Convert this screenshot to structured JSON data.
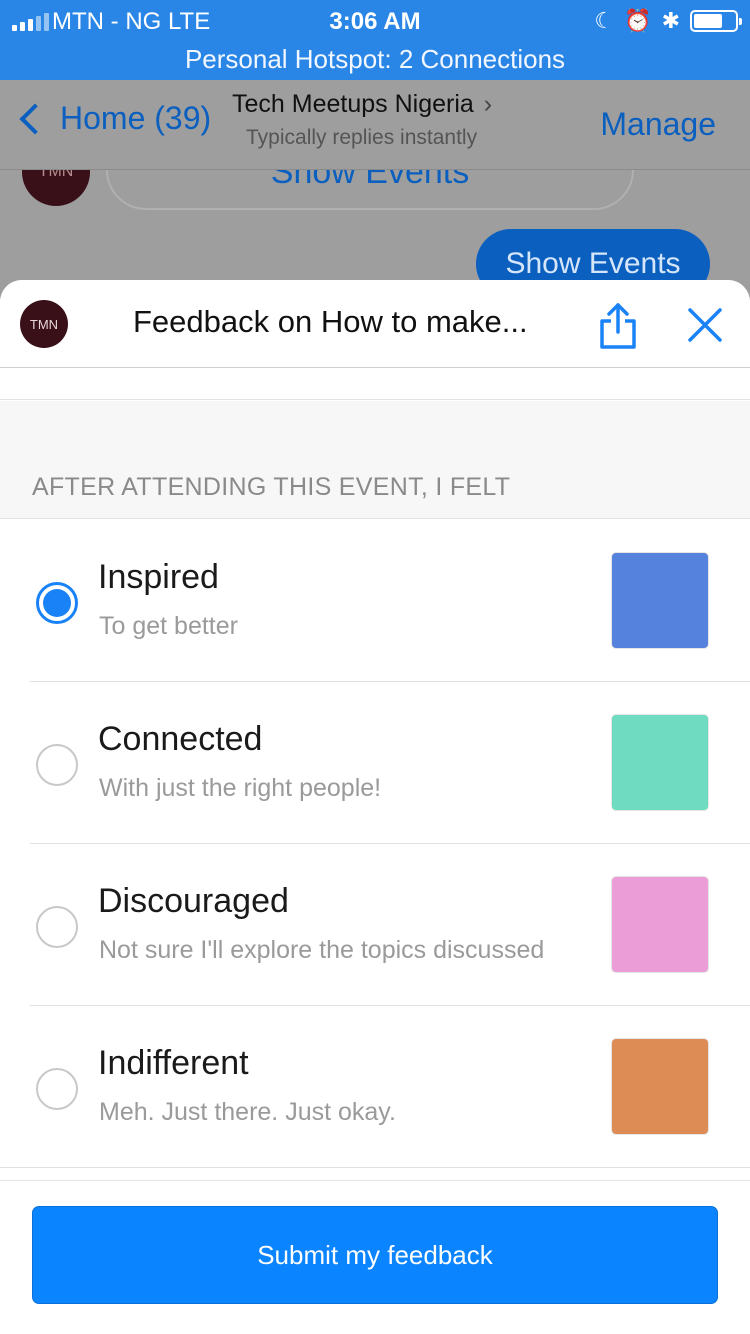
{
  "status_bar": {
    "carrier": "MTN - NG  LTE",
    "time": "3:06 AM",
    "hotspot": "Personal Hotspot: 2 Connections",
    "battery_level": 0.7
  },
  "chat_header": {
    "back_label": "Home (39)",
    "title": "Tech Meetups Nigeria",
    "subtitle": "Typically replies instantly",
    "manage_label": "Manage"
  },
  "chat": {
    "avatar_text": "TMN",
    "ghost_button": "Show Events",
    "bubble": "Show Events"
  },
  "sheet": {
    "avatar_text": "TMN",
    "title": "Feedback on How to make...",
    "section_title": "AFTER ATTENDING THIS EVENT, I FELT",
    "options": [
      {
        "label": "Inspired",
        "description": "To get better",
        "color": "#5582dc",
        "selected": true
      },
      {
        "label": "Connected",
        "description": "With just the right people!",
        "color": "#6fdbc0",
        "selected": false
      },
      {
        "label": "Discouraged",
        "description": "Not sure I'll explore the topics discussed",
        "color": "#eb9dd8",
        "selected": false
      },
      {
        "label": "Indifferent",
        "description": "Meh. Just there. Just okay.",
        "color": "#dd8c55",
        "selected": false
      }
    ],
    "submit_label": "Submit my feedback"
  }
}
